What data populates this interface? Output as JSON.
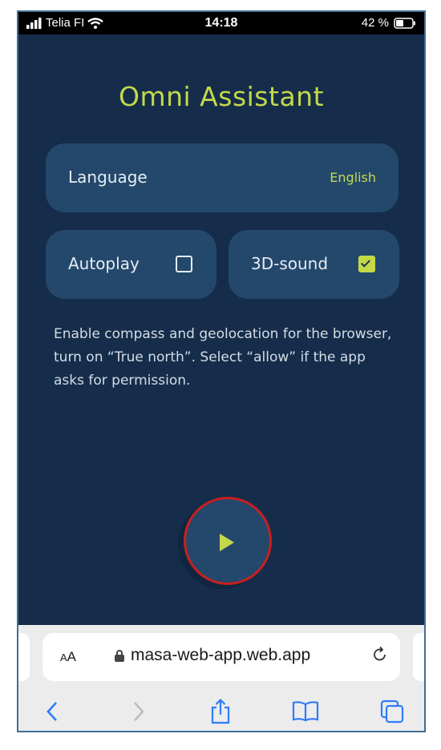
{
  "status_bar": {
    "carrier": "Telia FI",
    "time": "14:18",
    "battery": "42 %"
  },
  "app": {
    "title": "Omni Assistant",
    "language_label": "Language",
    "language_value": "English",
    "autoplay_label": "Autoplay",
    "autoplay_checked": false,
    "sound_label": "3D-sound",
    "sound_checked": true,
    "help_text": "Enable compass and geolocation for the browser, turn on “True north”. Select “allow” if the app asks for permission.",
    "accent_color": "#c3d94a",
    "background_color": "#152d4a",
    "card_color": "#24486c"
  },
  "browser": {
    "text_size_button": "AA",
    "url": "masa-web-app.web.app",
    "icons": {
      "reload": "reload-icon",
      "back": "back-icon",
      "forward": "forward-icon",
      "share": "share-icon",
      "bookmarks": "bookmarks-icon",
      "tabs": "tabs-icon"
    }
  }
}
